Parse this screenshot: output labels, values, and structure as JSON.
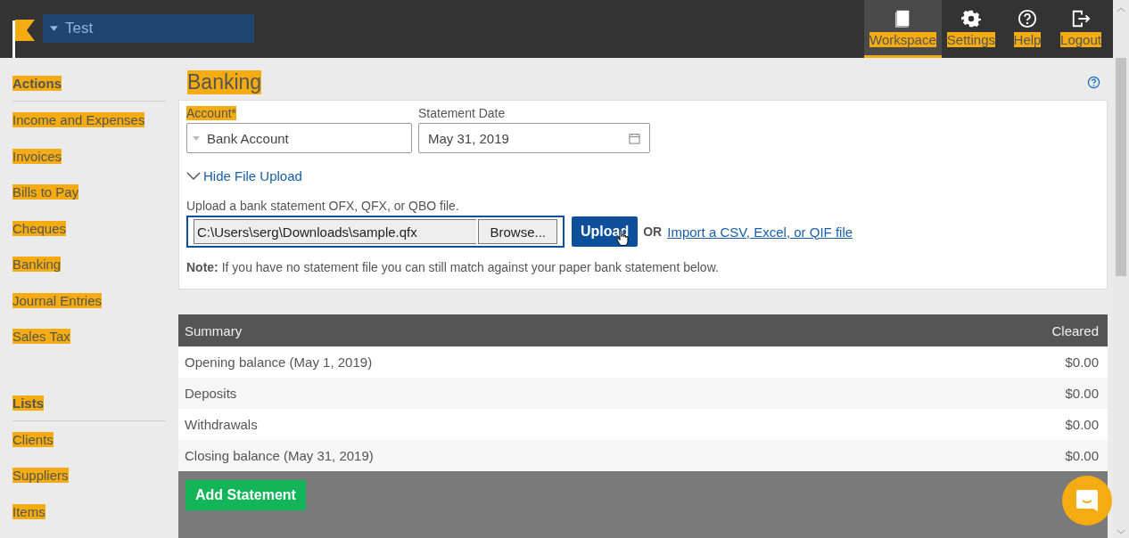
{
  "company": {
    "name": "Test"
  },
  "top_nav": [
    {
      "label": "Workspace",
      "kind": "workspace",
      "selected": true,
      "highlighted": true
    },
    {
      "label": "Settings",
      "kind": "settings",
      "selected": false,
      "highlighted": true
    },
    {
      "label": "Help",
      "kind": "help",
      "selected": false,
      "highlighted": true
    },
    {
      "label": "Logout",
      "kind": "logout",
      "selected": false,
      "highlighted": true
    }
  ],
  "sidebar": {
    "sections": [
      {
        "title": "Actions",
        "highlighted": true,
        "items": [
          {
            "label": "Income and Expenses",
            "highlighted": true
          },
          {
            "label": "Invoices",
            "highlighted": true
          },
          {
            "label": "Bills to Pay",
            "highlighted": true
          },
          {
            "label": "Cheques",
            "highlighted": true
          },
          {
            "label": "Banking",
            "highlighted": true
          },
          {
            "label": "Journal Entries",
            "highlighted": true
          },
          {
            "label": "Sales Tax",
            "highlighted": true
          }
        ]
      },
      {
        "title": "Lists",
        "highlighted": true,
        "items": [
          {
            "label": "Clients",
            "highlighted": true
          },
          {
            "label": "Suppliers",
            "highlighted": true
          },
          {
            "label": "Items",
            "highlighted": true
          }
        ]
      }
    ]
  },
  "page": {
    "title": "Banking",
    "title_highlighted": true
  },
  "form": {
    "account": {
      "label": "Account*",
      "highlighted": true,
      "value": "Bank Account"
    },
    "statement_date": {
      "label": "Statement Date",
      "value": "May 31, 2019"
    },
    "toggle": {
      "label": "Hide File Upload",
      "expanded": true
    },
    "upload_prompt": "Upload a bank statement OFX, QFX, or QBO file.",
    "file": {
      "value": "C:\\Users\\serg\\Downloads\\sample.qfx",
      "browse": "Browse..."
    },
    "upload_button": "Upload",
    "or": "OR",
    "import_link": "Import a CSV, Excel, or QIF file",
    "note": "**Note:** If you have no statement file you can still match against your paper bank statement below."
  },
  "summary": {
    "columns": [
      "Summary",
      "Cleared"
    ],
    "rows": [
      [
        "Opening balance (May 1, 2019)",
        "$0.00"
      ],
      [
        "Deposits",
        "$0.00"
      ],
      [
        "Withdrawals",
        "$0.00"
      ],
      [
        "Closing balance (May 31, 2019)",
        "$0.00"
      ]
    ]
  },
  "footer": {
    "button": "Add Statement"
  }
}
